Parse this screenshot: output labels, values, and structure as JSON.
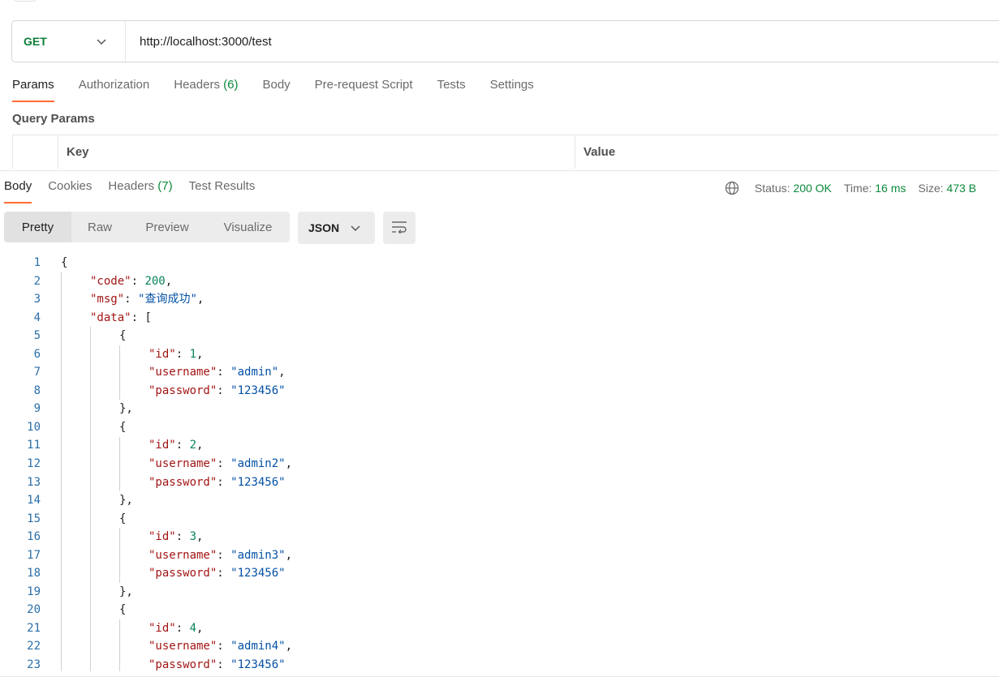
{
  "request": {
    "method": "GET",
    "url": "http://localhost:3000/test"
  },
  "request_tabs": [
    {
      "label": "Params"
    },
    {
      "label": "Authorization"
    },
    {
      "label": "Headers",
      "count": "(6)"
    },
    {
      "label": "Body"
    },
    {
      "label": "Pre-request Script"
    },
    {
      "label": "Tests"
    },
    {
      "label": "Settings"
    }
  ],
  "query_params": {
    "title": "Query Params",
    "col_key": "Key",
    "col_value": "Value"
  },
  "response_tabs": [
    {
      "label": "Body"
    },
    {
      "label": "Cookies"
    },
    {
      "label": "Headers",
      "count": "(7)"
    },
    {
      "label": "Test Results"
    }
  ],
  "status_bar": {
    "status_label": "Status:",
    "status_value": "200 OK",
    "time_label": "Time:",
    "time_value": "16 ms",
    "size_label": "Size:",
    "size_value": "473 B"
  },
  "view_modes": [
    "Pretty",
    "Raw",
    "Preview",
    "Visualize"
  ],
  "format": "JSON",
  "icons": {
    "method_dropdown": "chevron-down-icon",
    "globe": "globe-icon",
    "format_dropdown": "chevron-down-icon",
    "wrap": "wrap-lines-icon"
  },
  "colors": {
    "accent": "#ff6c37",
    "get_method": "#0b7f37",
    "success": "#0b8a3b",
    "json_key": "#a31515",
    "json_string": "#0451a5",
    "json_number": "#098658",
    "line_number": "#2b6fa8"
  },
  "response_lines": [
    [
      [
        "p",
        "{"
      ]
    ],
    [
      [
        "k",
        "\"code\""
      ],
      [
        "p",
        ": "
      ],
      [
        "n",
        "200"
      ],
      [
        "p",
        ","
      ]
    ],
    [
      [
        "k",
        "\"msg\""
      ],
      [
        "p",
        ": "
      ],
      [
        "s",
        "\"查询成功\""
      ],
      [
        "p",
        ","
      ]
    ],
    [
      [
        "k",
        "\"data\""
      ],
      [
        "p",
        ": ["
      ]
    ],
    [
      [
        "p",
        "{"
      ]
    ],
    [
      [
        "k",
        "\"id\""
      ],
      [
        "p",
        ": "
      ],
      [
        "n",
        "1"
      ],
      [
        "p",
        ","
      ]
    ],
    [
      [
        "k",
        "\"username\""
      ],
      [
        "p",
        ": "
      ],
      [
        "s",
        "\"admin\""
      ],
      [
        "p",
        ","
      ]
    ],
    [
      [
        "k",
        "\"password\""
      ],
      [
        "p",
        ": "
      ],
      [
        "s",
        "\"123456\""
      ]
    ],
    [
      [
        "p",
        "},"
      ]
    ],
    [
      [
        "p",
        "{"
      ]
    ],
    [
      [
        "k",
        "\"id\""
      ],
      [
        "p",
        ": "
      ],
      [
        "n",
        "2"
      ],
      [
        "p",
        ","
      ]
    ],
    [
      [
        "k",
        "\"username\""
      ],
      [
        "p",
        ": "
      ],
      [
        "s",
        "\"admin2\""
      ],
      [
        "p",
        ","
      ]
    ],
    [
      [
        "k",
        "\"password\""
      ],
      [
        "p",
        ": "
      ],
      [
        "s",
        "\"123456\""
      ]
    ],
    [
      [
        "p",
        "},"
      ]
    ],
    [
      [
        "p",
        "{"
      ]
    ],
    [
      [
        "k",
        "\"id\""
      ],
      [
        "p",
        ": "
      ],
      [
        "n",
        "3"
      ],
      [
        "p",
        ","
      ]
    ],
    [
      [
        "k",
        "\"username\""
      ],
      [
        "p",
        ": "
      ],
      [
        "s",
        "\"admin3\""
      ],
      [
        "p",
        ","
      ]
    ],
    [
      [
        "k",
        "\"password\""
      ],
      [
        "p",
        ": "
      ],
      [
        "s",
        "\"123456\""
      ]
    ],
    [
      [
        "p",
        "},"
      ]
    ],
    [
      [
        "p",
        "{"
      ]
    ],
    [
      [
        "k",
        "\"id\""
      ],
      [
        "p",
        ": "
      ],
      [
        "n",
        "4"
      ],
      [
        "p",
        ","
      ]
    ],
    [
      [
        "k",
        "\"username\""
      ],
      [
        "p",
        ": "
      ],
      [
        "s",
        "\"admin4\""
      ],
      [
        "p",
        ","
      ]
    ],
    [
      [
        "k",
        "\"password\""
      ],
      [
        "p",
        ": "
      ],
      [
        "s",
        "\"123456\""
      ]
    ]
  ]
}
